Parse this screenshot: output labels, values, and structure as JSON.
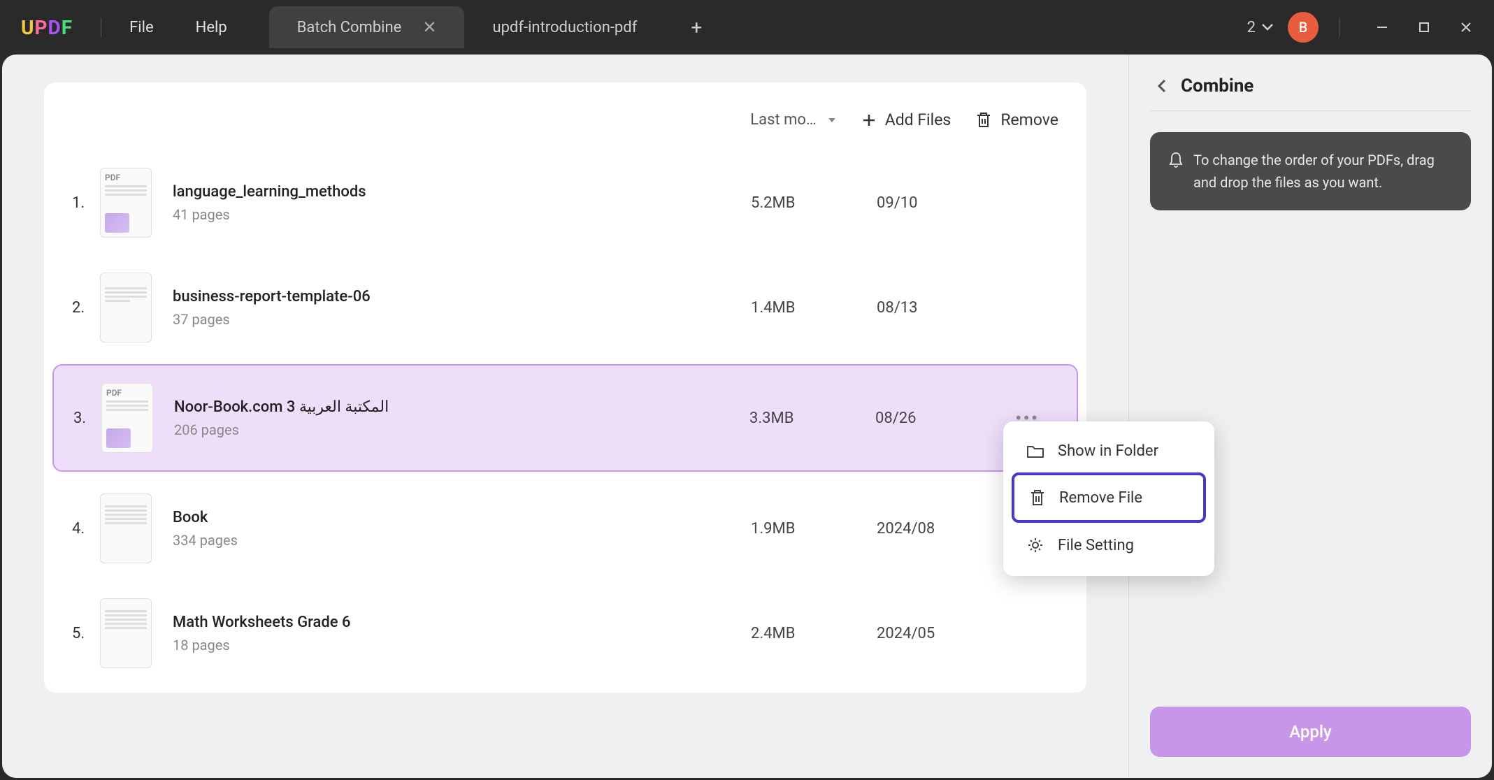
{
  "titlebar": {
    "menu": {
      "file": "File",
      "help": "Help"
    },
    "tabs": [
      {
        "label": "Batch Combine",
        "active": true,
        "closable": true
      },
      {
        "label": "updf-introduction-pdf",
        "active": false,
        "closable": false
      }
    ],
    "tab_count": "2",
    "avatar_letter": "B"
  },
  "toolbar": {
    "sort_label": "Last mo…",
    "add_files": "Add Files",
    "remove": "Remove"
  },
  "files": [
    {
      "index": "1.",
      "name": "language_learning_methods",
      "pages": "41 pages",
      "size": "5.2MB",
      "date": "09/10",
      "thumb_type": "pdf"
    },
    {
      "index": "2.",
      "name": "business-report-template-06",
      "pages": "37 pages",
      "size": "1.4MB",
      "date": "08/13",
      "thumb_type": "doc"
    },
    {
      "index": "3.",
      "name": "Noor-Book.com  3 المكتبة العربية",
      "pages": "206 pages",
      "size": "3.3MB",
      "date": "08/26",
      "thumb_type": "pdf",
      "selected": true
    },
    {
      "index": "4.",
      "name": "Book",
      "pages": "334 pages",
      "size": "1.9MB",
      "date": "2024/08",
      "thumb_type": "doc"
    },
    {
      "index": "5.",
      "name": "Math Worksheets Grade 6",
      "pages": "18 pages",
      "size": "2.4MB",
      "date": "2024/05",
      "thumb_type": "doc"
    }
  ],
  "context_menu": {
    "show_in_folder": "Show in Folder",
    "remove_file": "Remove File",
    "file_setting": "File Setting"
  },
  "side": {
    "title": "Combine",
    "tip": "To change the order of your PDFs, drag and drop the files as you want.",
    "apply": "Apply"
  }
}
